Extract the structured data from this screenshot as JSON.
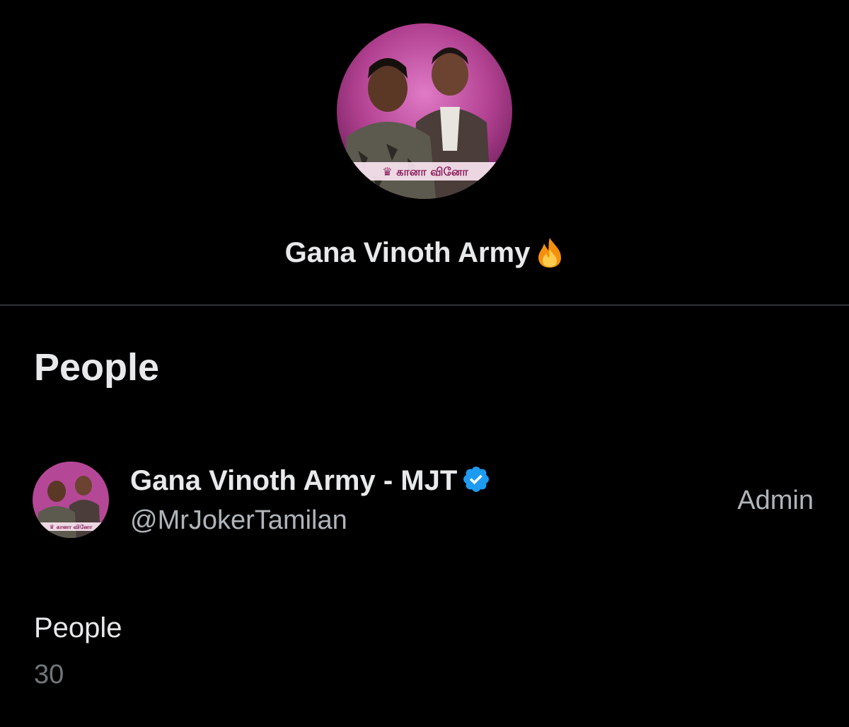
{
  "community": {
    "title": "Gana Vinoth Army",
    "title_icon": "fire-emoji-icon",
    "avatar_caption": "கானா வினோ",
    "avatar_colors": {
      "background": "#c04fa0",
      "accent": "#f5c542"
    }
  },
  "people_section": {
    "heading": "People",
    "members": [
      {
        "name": "Gana Vinoth Army - MJT",
        "verified": true,
        "verified_icon": "verified-badge-icon",
        "handle": "@MrJokerTamilan",
        "role": "Admin"
      }
    ]
  },
  "stats": {
    "people_label": "People",
    "people_count": "30"
  },
  "colors": {
    "background": "#000000",
    "text_primary": "#e7e9ea",
    "text_secondary": "#71767b",
    "divider": "#2f3336",
    "verified_blue": "#1d9bf0"
  }
}
